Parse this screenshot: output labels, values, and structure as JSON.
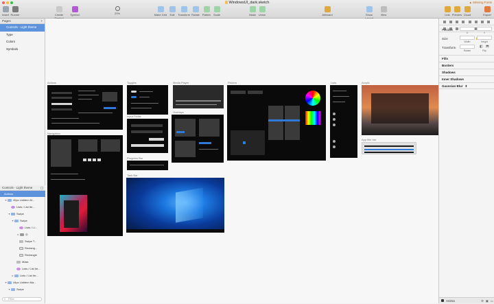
{
  "window": {
    "title": "WindowsUI_dark.sketch",
    "missing_fonts": "Missing Fonts"
  },
  "toolbar": {
    "insert": "Insert",
    "runner": "Runner",
    "create_symbol": "Create Symbol",
    "symbol": "Symbol",
    "zoom_value": "22%",
    "make_grid": "Make Grid",
    "edit": "Edit",
    "transform": "Transform",
    "rotate": "Rotate",
    "flatten": "Flatten",
    "scale": "Scale",
    "mask": "Mask",
    "union": "Union",
    "artboard": "Artboard",
    "show_layout": "Show Layout",
    "view": "View",
    "link": "Link",
    "preview": "Preview",
    "cloud": "Cloud",
    "export": "Export"
  },
  "pages_panel": {
    "header": "Pages",
    "pages": [
      "Controls - Light theme",
      "Type",
      "Colors",
      "Symbols"
    ]
  },
  "layers_panel": {
    "header": "Controls - Light theme",
    "layers": [
      {
        "label": "Actions"
      },
      {
        "label": "40px Listitem M..."
      },
      {
        "label": "Lists / List Ite..."
      },
      {
        "label": "Swipe"
      },
      {
        "label": "Swipe"
      },
      {
        "label": "Lists / Li..."
      },
      {
        "label": "◎"
      },
      {
        "label": "Swipe T..."
      },
      {
        "label": "Rectang..."
      },
      {
        "label": "Rectangle"
      },
      {
        "label": "Mask"
      },
      {
        "label": "Lists / List Ite..."
      },
      {
        "label": "Lists / List Ite..."
      },
      {
        "label": "44px Listitem Ma..."
      },
      {
        "label": "Swipe"
      }
    ],
    "filter_placeholder": "Filter"
  },
  "inspector": {
    "position": "Position",
    "x": "X",
    "y": "Y",
    "size": "Size",
    "width": "Width",
    "height": "Height",
    "transform": "Transform",
    "rotate": "Rotate",
    "flip": "Flip",
    "fills": "Fills",
    "borders": "Borders",
    "shadows": "Shadows",
    "inner_shadows": "Inner Shadows",
    "gaussian_blur": "Gaussian Blur",
    "anima": "Anima"
  },
  "artboards": [
    {
      "name": "Actions"
    },
    {
      "name": "Toggles"
    },
    {
      "name": "Media Player"
    },
    {
      "name": "Pickers"
    },
    {
      "name": "Lists"
    },
    {
      "name": "Acrylic"
    },
    {
      "name": "Input Fields"
    },
    {
      "name": "Overlays"
    },
    {
      "name": "Navigation"
    },
    {
      "name": "Progress Bar"
    },
    {
      "name": "App title bar"
    },
    {
      "name": "Task Bar"
    }
  ],
  "colors": {
    "selection": "#5d93dc",
    "artboard_bg": "#0a0a0a",
    "accent_blue": "#2f7ad6",
    "missing_fonts": "#c86a10"
  }
}
